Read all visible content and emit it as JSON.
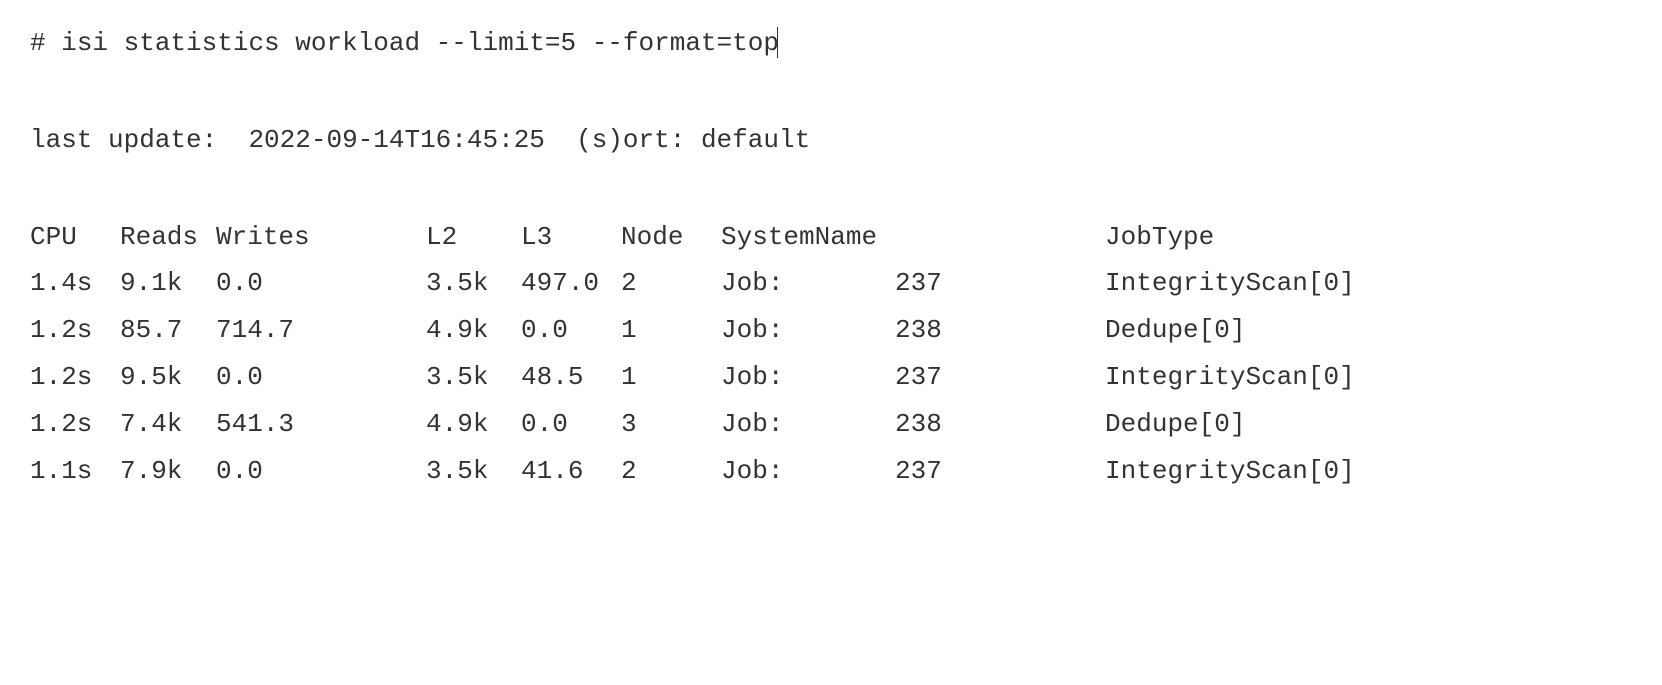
{
  "command": {
    "prompt": "#",
    "text": "isi statistics workload --limit=5 --format=top"
  },
  "status": {
    "label_update": "last update:",
    "timestamp": "2022-09-14T16:45:25",
    "label_sort": "(s)ort:",
    "sort_value": "default"
  },
  "headers": {
    "cpu": "CPU",
    "reads": "Reads",
    "writes": "Writes",
    "l2": "L2",
    "l3": "L3",
    "node": "Node",
    "systemname": "SystemName",
    "jobtype": "JobType"
  },
  "rows": [
    {
      "cpu": "1.4s",
      "reads": "9.1k",
      "writes": "0.0",
      "l2": "3.5k",
      "l3": "497.0",
      "node": "2",
      "syslabel": "Job:",
      "sysid": "237",
      "jobtype": "IntegrityScan[0]"
    },
    {
      "cpu": "1.2s",
      "reads": "85.7",
      "writes": "714.7",
      "l2": "4.9k",
      "l3": "0.0",
      "node": "1",
      "syslabel": "Job:",
      "sysid": "238",
      "jobtype": "Dedupe[0]"
    },
    {
      "cpu": "1.2s",
      "reads": "9.5k",
      "writes": "0.0",
      "l2": "3.5k",
      "l3": "48.5",
      "node": "1",
      "syslabel": "Job:",
      "sysid": "237",
      "jobtype": "IntegrityScan[0]"
    },
    {
      "cpu": "1.2s",
      "reads": "7.4k",
      "writes": "541.3",
      "l2": "4.9k",
      "l3": "0.0",
      "node": "3",
      "syslabel": "Job:",
      "sysid": "238",
      "jobtype": "Dedupe[0]"
    },
    {
      "cpu": "1.1s",
      "reads": "7.9k",
      "writes": "0.0",
      "l2": "3.5k",
      "l3": "41.6",
      "node": "2",
      "syslabel": "Job:",
      "sysid": "237",
      "jobtype": "IntegrityScan[0]"
    }
  ]
}
